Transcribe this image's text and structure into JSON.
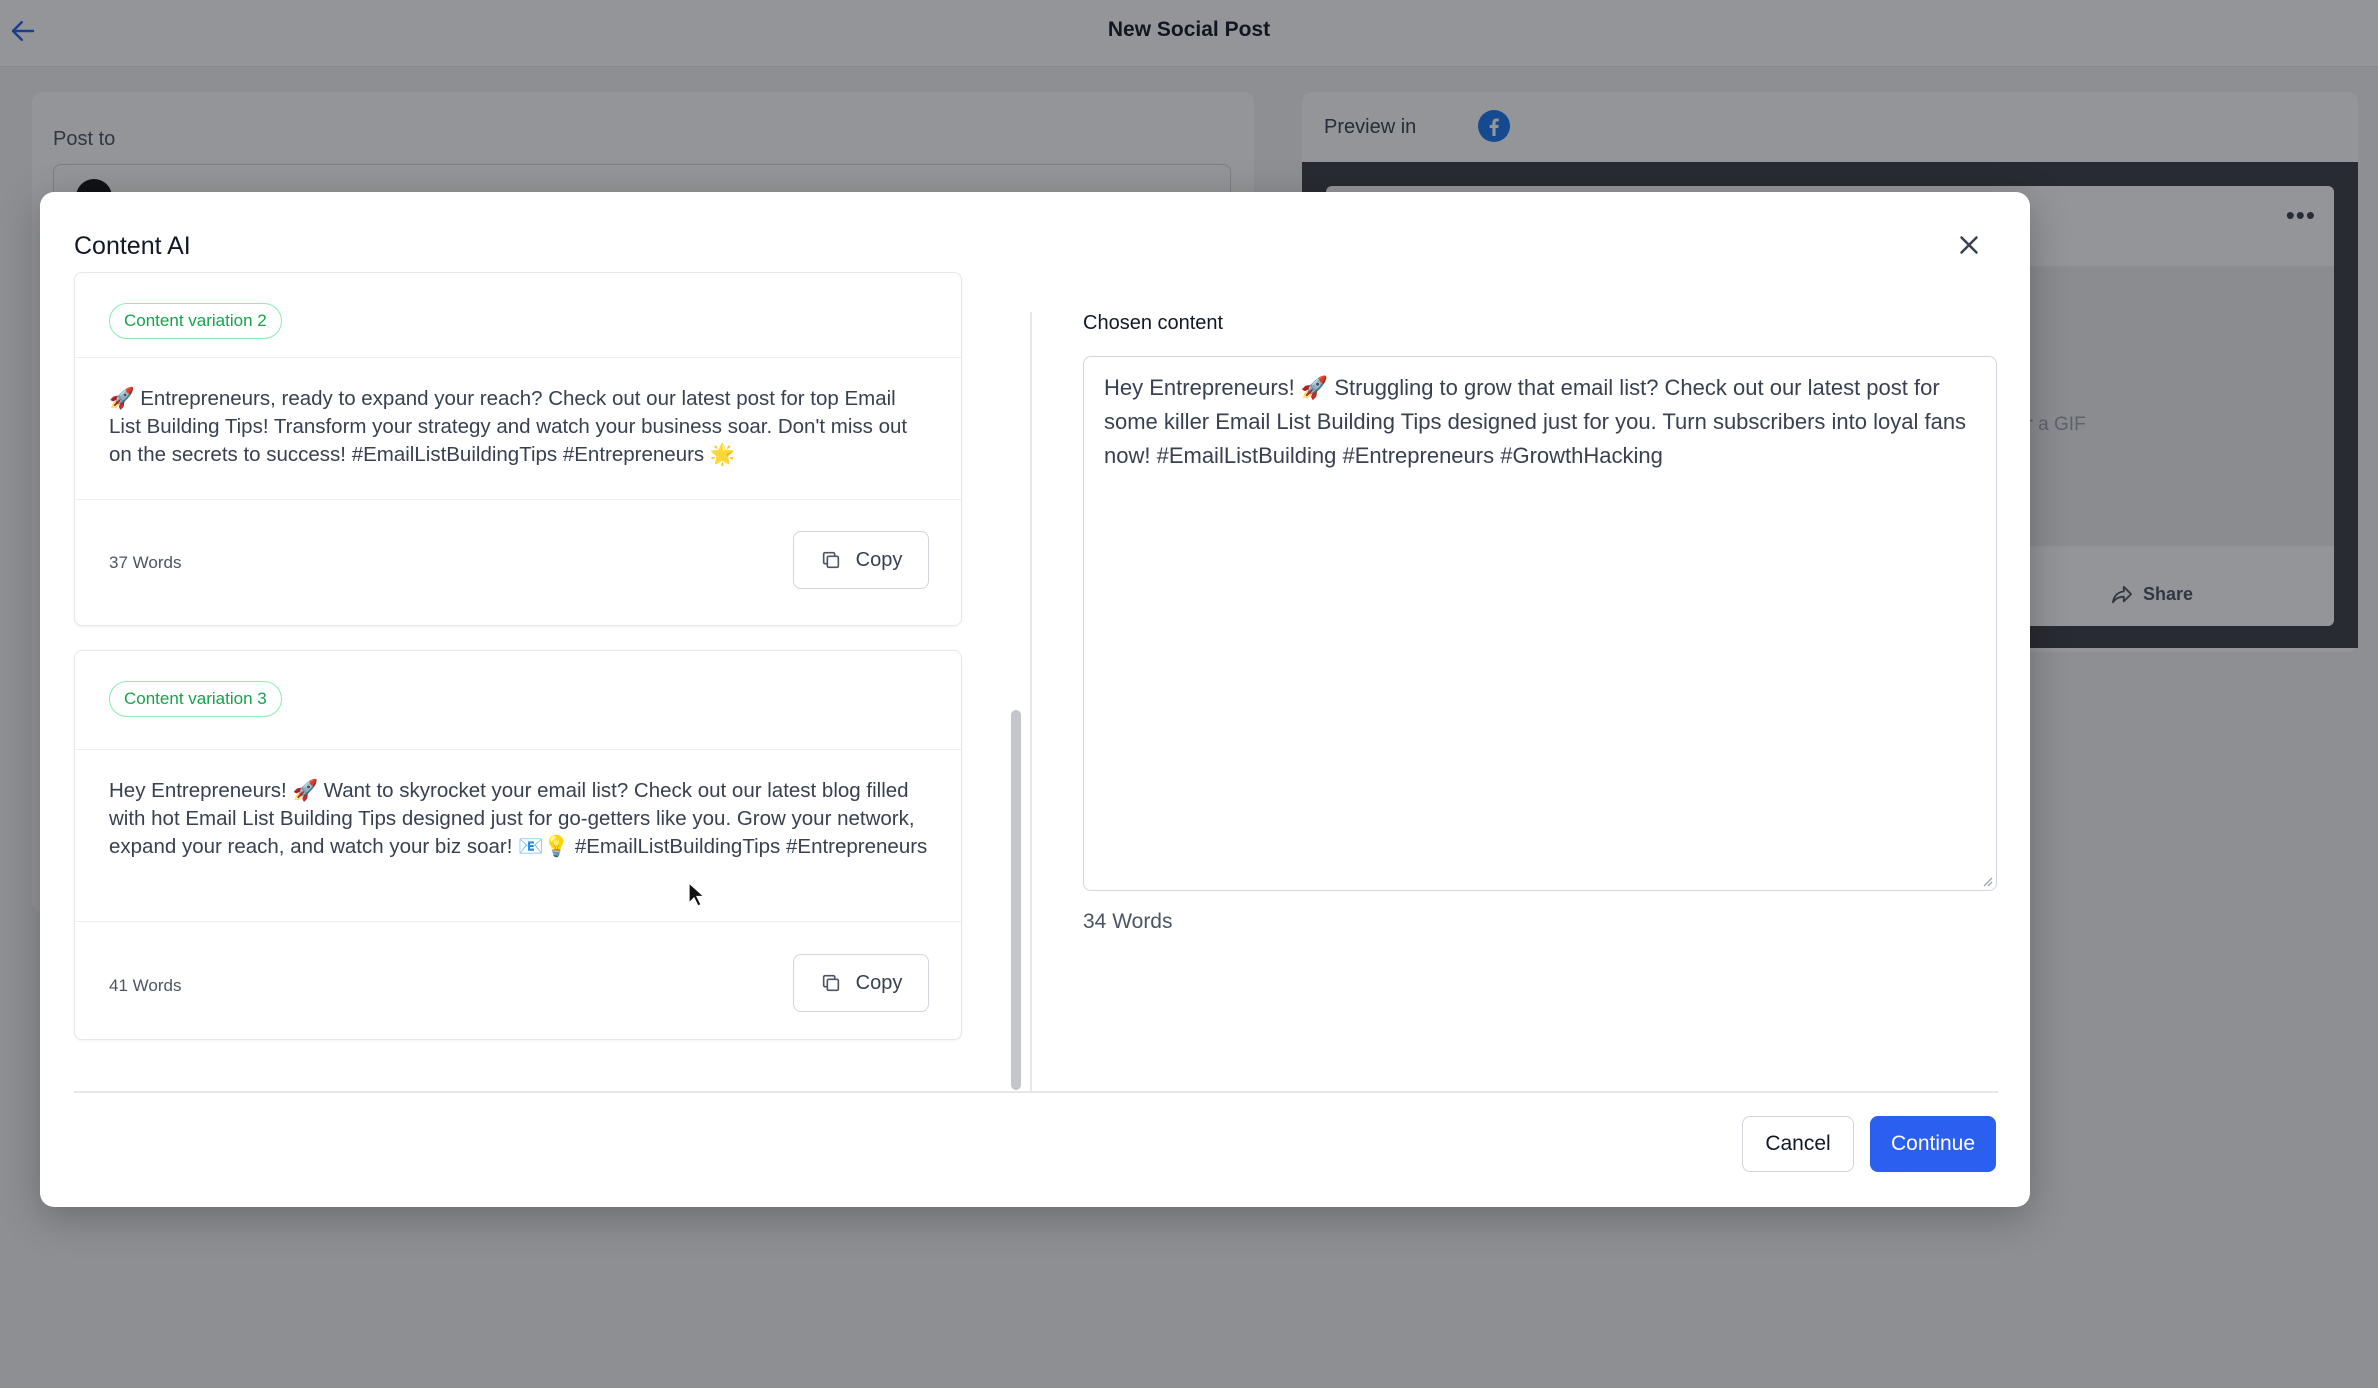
{
  "page": {
    "title": "New Social Post",
    "post_to_label": "Post to",
    "preview_label": "Preview in",
    "preview_network_icon": "facebook-icon",
    "share_label": "Share",
    "gif_hint": "or a GIF"
  },
  "modal": {
    "title": "Content AI",
    "variations": [
      {
        "badge": "Content variation 2",
        "text": "🚀 Entrepreneurs, ready to expand your reach? Check out our latest post for top Email List Building Tips! Transform your strategy and watch your business soar. Don't miss out on the secrets to success! #EmailListBuildingTips #Entrepreneurs 🌟",
        "word_count": "37 Words",
        "copy_label": "Copy"
      },
      {
        "badge": "Content variation 3",
        "text": "Hey Entrepreneurs! 🚀 Want to skyrocket your email list? Check out our latest blog filled with hot Email List Building Tips designed just for go-getters like you. Grow your network, expand your reach, and watch your biz soar! 📧💡 #EmailListBuildingTips #Entrepreneurs",
        "word_count": "41 Words",
        "copy_label": "Copy"
      }
    ],
    "chosen": {
      "label": "Chosen content",
      "text": "Hey Entrepreneurs! 🚀 Struggling to grow that email list? Check out our latest post for some killer Email List Building Tips designed just for you. Turn subscribers into loyal fans now! #EmailListBuilding #Entrepreneurs #GrowthHacking",
      "word_count": "34 Words"
    },
    "actions": {
      "cancel": "Cancel",
      "continue": "Continue"
    }
  },
  "colors": {
    "accent": "#2b5ff0",
    "badge_green": "#16a34a",
    "badge_border": "#86efac",
    "facebook_blue": "#1877f2"
  }
}
